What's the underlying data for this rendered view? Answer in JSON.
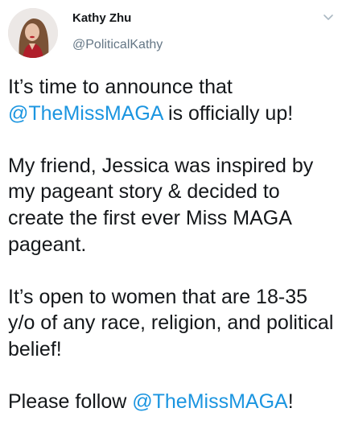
{
  "user": {
    "name": "Kathy Zhu",
    "handle": "@PoliticalKathy"
  },
  "tweet": {
    "p1_before": "It’s time to announce that ",
    "p1_mention": "@TheMissMAGA",
    "p1_after": " is officially up!",
    "p2": "My friend, Jessica was inspired by my pageant story & decided to create the first ever Miss MAGA pageant.",
    "p3": "It’s open to women that are 18-35 y/o of any race, religion, and political belief!",
    "p4_before": "Please follow ",
    "p4_mention": "@TheMissMAGA",
    "p4_after": "!"
  },
  "icons": {
    "menu": "chevron-down-icon"
  },
  "colors": {
    "link": "#1b95e0",
    "text": "#14171a",
    "secondary": "#657786"
  }
}
